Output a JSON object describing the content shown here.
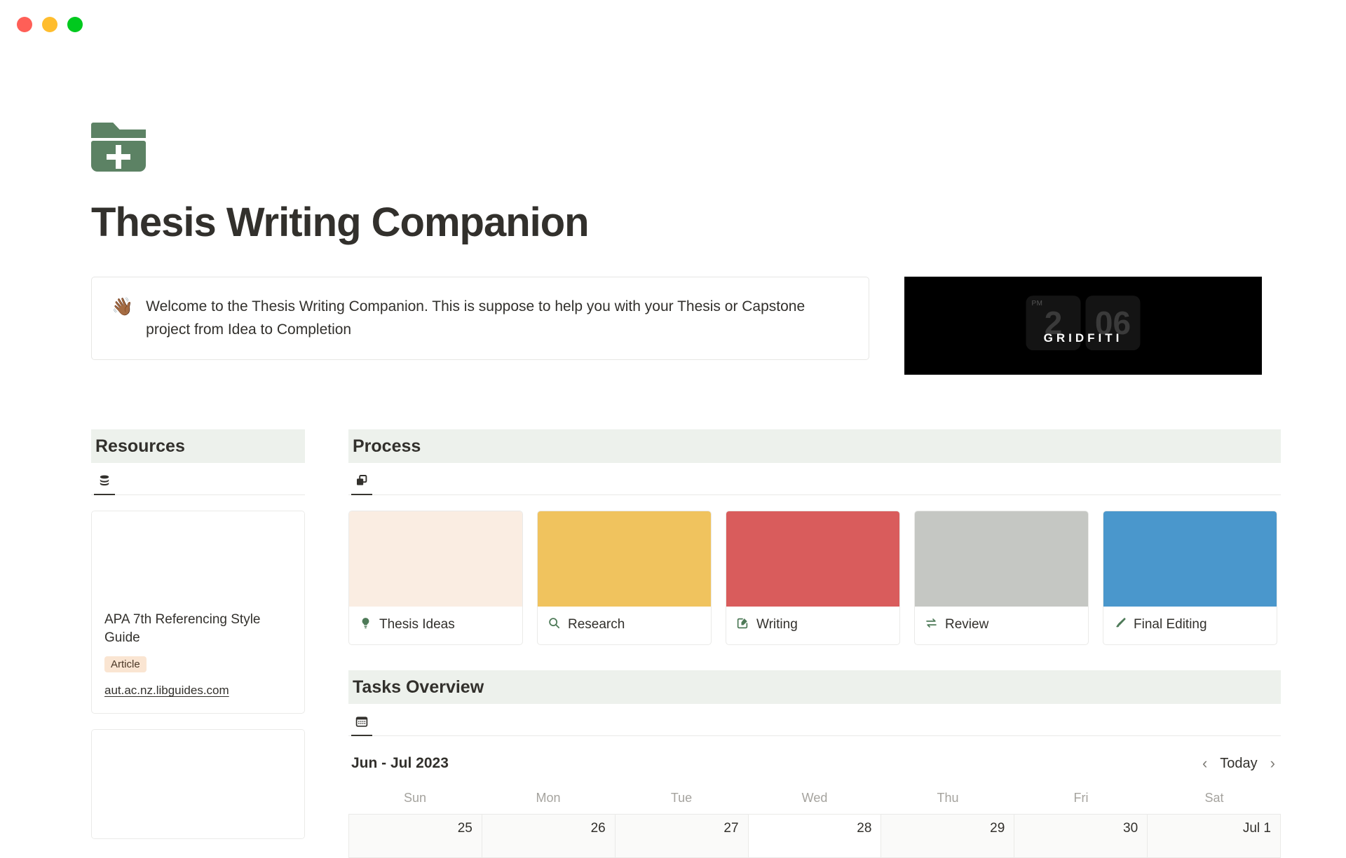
{
  "window": {
    "traffic_lights": [
      {
        "name": "close",
        "color": "#FF5F57"
      },
      {
        "name": "minimize",
        "color": "#FFBD2E"
      },
      {
        "name": "maximize",
        "color": "#00C91E"
      }
    ]
  },
  "page": {
    "icon": "folder-plus-icon",
    "icon_color": "#5C8264",
    "title": "Thesis Writing Companion"
  },
  "callout": {
    "emoji": "👋🏾",
    "text": "Welcome to the Thesis Writing Companion. This is suppose to help you with your Thesis or Capstone project from Idea to Completion"
  },
  "banner": {
    "brand": "GRIDFITI",
    "clock_meridiem": "PM",
    "clock_hour": "2",
    "clock_minute": "06",
    "background": "#000000"
  },
  "resources": {
    "title": "Resources",
    "view_icon": "database-icon",
    "cards": [
      {
        "title": "APA 7th Referencing Style Guide",
        "tag": "Article",
        "tag_color": "#FAE5D2",
        "url": "aut.ac.nz.libguides.com"
      },
      {
        "title": "",
        "tag": "",
        "url": ""
      }
    ]
  },
  "process": {
    "title": "Process",
    "view_icon": "gallery-icon",
    "cards": [
      {
        "label": "Thesis Ideas",
        "icon": "lightbulb-icon",
        "cover_color": "#FAEDE2"
      },
      {
        "label": "Research",
        "icon": "magnifier-icon",
        "cover_color": "#F0C35E"
      },
      {
        "label": "Writing",
        "icon": "edit-square-icon",
        "cover_color": "#D95C5C"
      },
      {
        "label": "Review",
        "icon": "swap-arrows-icon",
        "cover_color": "#C5C7C3"
      },
      {
        "label": "Final Editing",
        "icon": "paintbrush-icon",
        "cover_color": "#4A97CC"
      }
    ]
  },
  "tasks": {
    "title": "Tasks Overview",
    "view_icon": "calendar-icon",
    "calendar": {
      "month_label": "Jun - Jul 2023",
      "today_label": "Today",
      "prev_icon": "chevron-left-icon",
      "next_icon": "chevron-right-icon",
      "day_names": [
        "Sun",
        "Mon",
        "Tue",
        "Wed",
        "Thu",
        "Fri",
        "Sat"
      ],
      "days": [
        {
          "label": "25",
          "current_month": false
        },
        {
          "label": "26",
          "current_month": false
        },
        {
          "label": "27",
          "current_month": false
        },
        {
          "label": "28",
          "current_month": true
        },
        {
          "label": "29",
          "current_month": false
        },
        {
          "label": "30",
          "current_month": false
        },
        {
          "label": "Jul 1",
          "current_month": false
        }
      ]
    }
  }
}
